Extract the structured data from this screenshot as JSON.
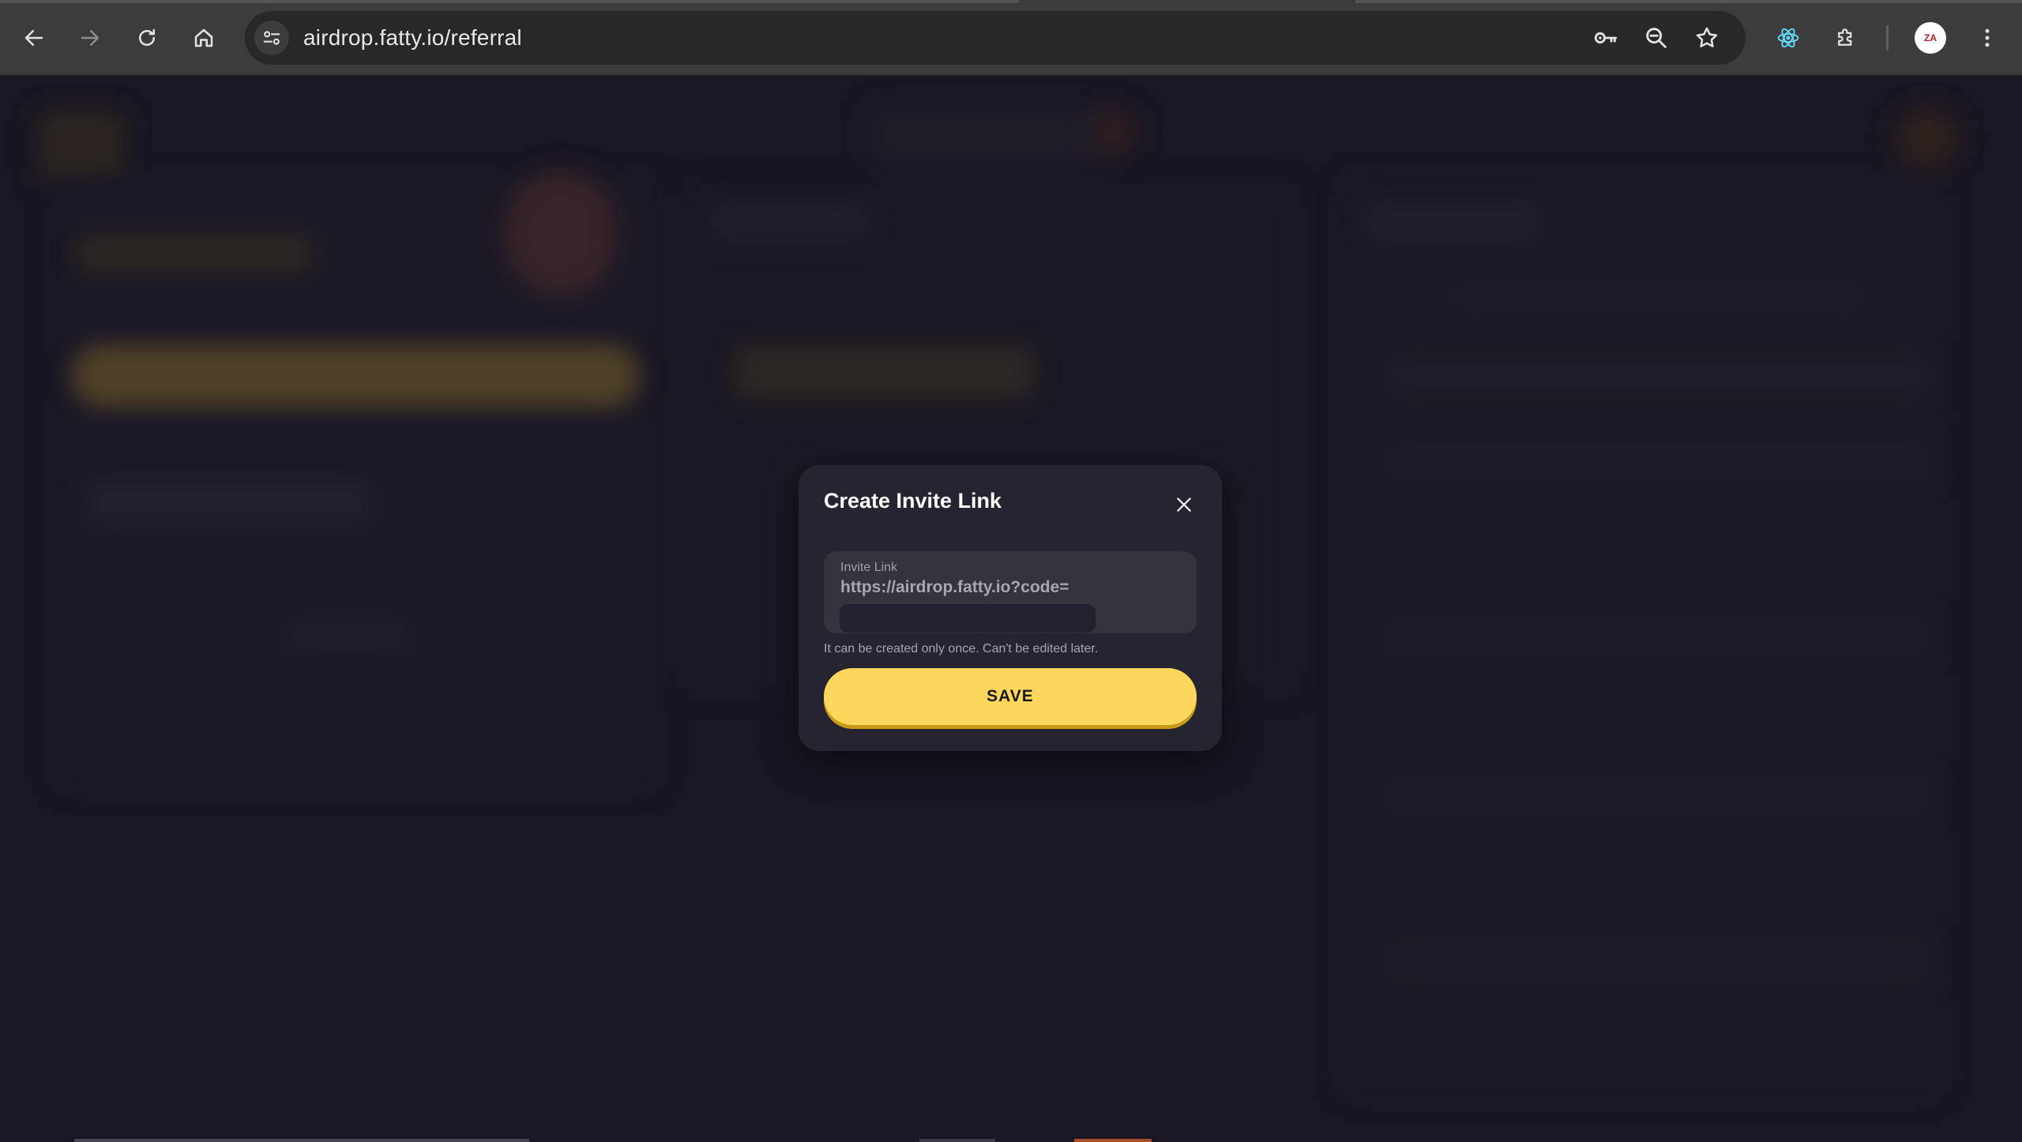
{
  "browser": {
    "url": "airdrop.fatty.io/referral",
    "avatar_text": "ZA",
    "icons": [
      "back-arrow-icon",
      "forward-arrow-icon",
      "reload-icon",
      "home-icon",
      "site-info-icon",
      "password-key-icon",
      "zoom-icon",
      "bookmark-star-icon",
      "react-devtools-icon",
      "extensions-puzzle-icon",
      "profile-avatar-icon",
      "more-menu-icon"
    ]
  },
  "modal": {
    "title": "Create Invite Link",
    "field_label": "Invite Link",
    "url_prefix": "https://airdrop.fatty.io?code=",
    "input_value": "",
    "hint": "It can be created only once. Can't be edited later.",
    "save_label": "SAVE"
  },
  "colors": {
    "accent": "#fdd65c",
    "accent_shadow": "#c99a1a",
    "modal_bg": "#272432",
    "page_bg": "#1a1724",
    "chrome_bg": "#3c3c3c"
  }
}
